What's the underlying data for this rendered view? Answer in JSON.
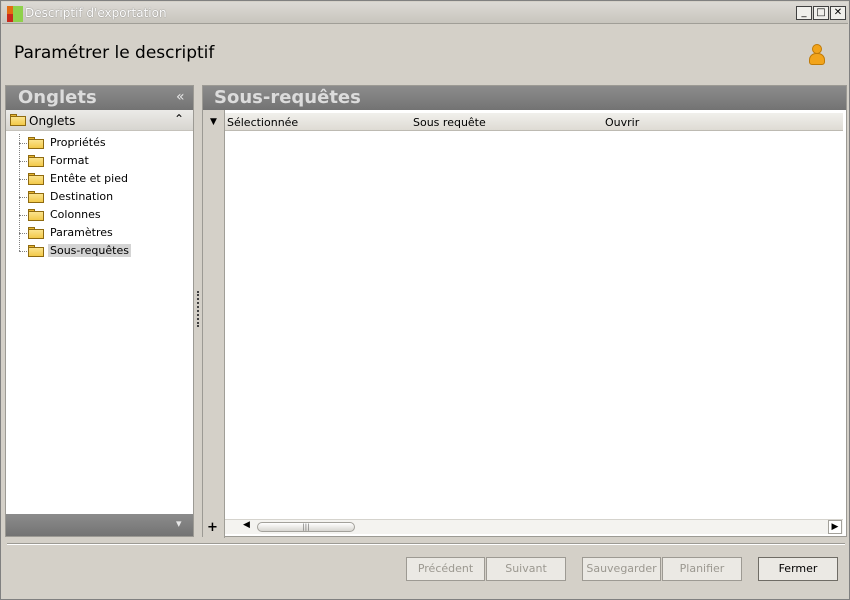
{
  "window": {
    "title": "Descriptif d'exportation",
    "min_glyph": "_",
    "max_glyph": "□",
    "close_glyph": "✕"
  },
  "header": {
    "title": "Paramétrer le descriptif",
    "user_icon": "user-icon"
  },
  "left_panel": {
    "title": "Onglets",
    "collapse_glyph": "«",
    "group": {
      "title": "Onglets",
      "collapse_glyph": "⌃"
    },
    "items": [
      {
        "label": "Propriétés"
      },
      {
        "label": "Format"
      },
      {
        "label": "Entête et pied"
      },
      {
        "label": "Destination"
      },
      {
        "label": "Colonnes"
      },
      {
        "label": "Paramètres"
      },
      {
        "label": "Sous-requêtes"
      }
    ],
    "selected_index": 6,
    "footer_glyph": "▾"
  },
  "right_panel": {
    "title": "Sous-requêtes",
    "menu_glyph": "▼",
    "columns": [
      "Sélectionnée",
      "Sous requête",
      "Ouvrir"
    ],
    "rows": [],
    "add_glyph": "+",
    "scroll_left_glyph": "◀",
    "scroll_right_glyph": "▶",
    "scroll_grip": "|||"
  },
  "buttons": {
    "previous": "Précédent",
    "next": "Suivant",
    "save": "Sauvegarder",
    "schedule": "Planifier",
    "close": "Fermer"
  },
  "colors": {
    "panel_header": "#7f7f7f",
    "window_bg": "#d4d0c8",
    "folder": "#f2c94a"
  }
}
